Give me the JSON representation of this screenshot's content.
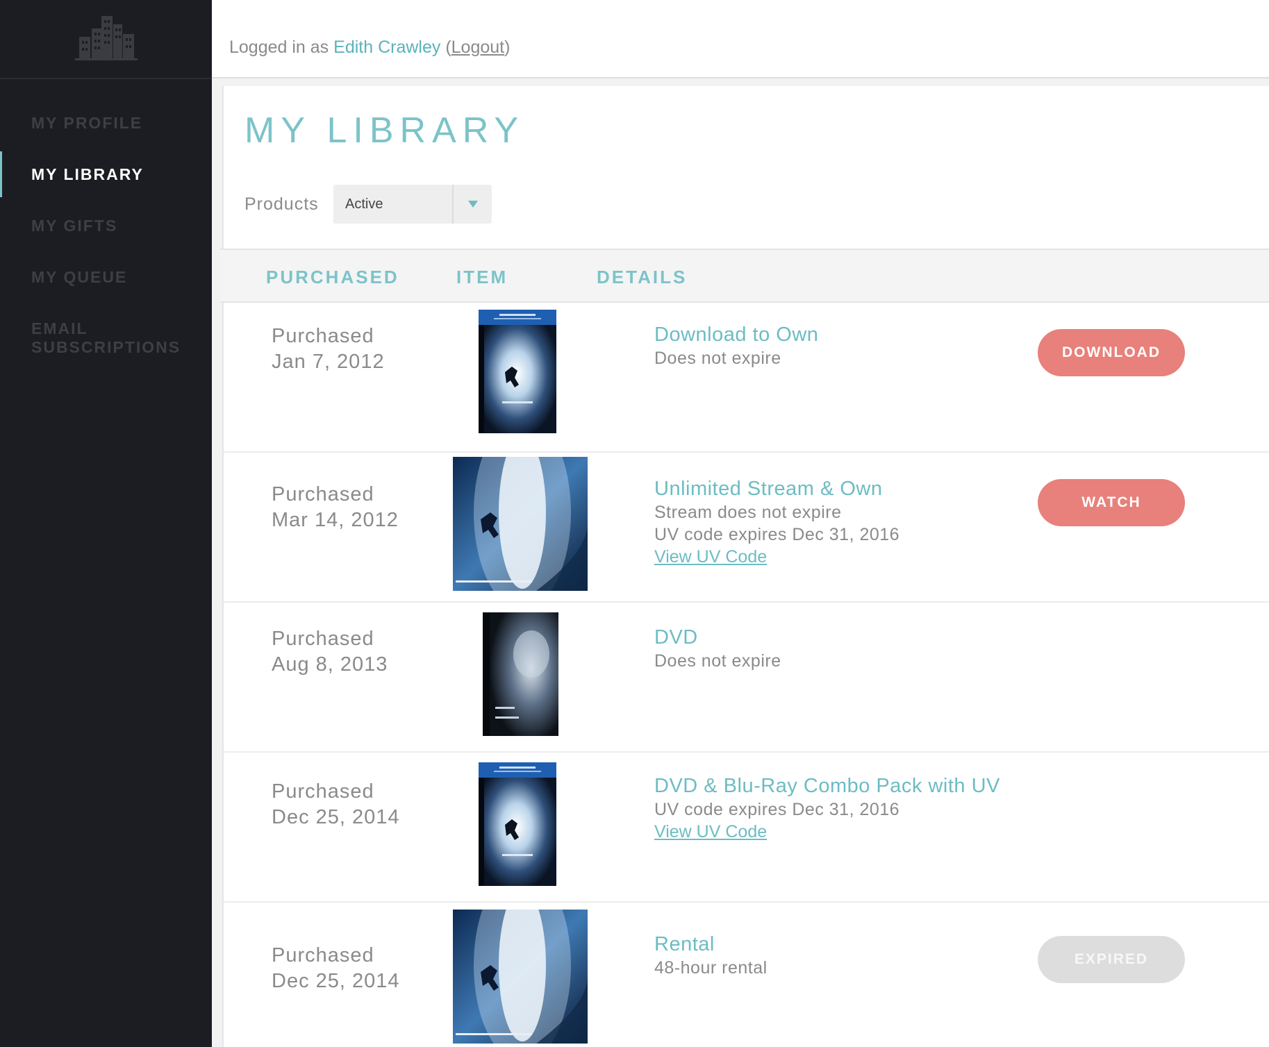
{
  "colors": {
    "accent": "#7cc3c9",
    "button": "#e8807b",
    "sidebar": "#1c1d22",
    "disabled": "#dddddd"
  },
  "sidebar": {
    "logo_icon": "city-buildings-icon",
    "items": [
      {
        "label": "MY PROFILE",
        "active": false
      },
      {
        "label": "MY LIBRARY",
        "active": true
      },
      {
        "label": "MY GIFTS",
        "active": false
      },
      {
        "label": "MY QUEUE",
        "active": false
      },
      {
        "label": "EMAIL SUBSCRIPTIONS",
        "active": false
      }
    ]
  },
  "header": {
    "logged_in_prefix": "Logged in as",
    "user_name": "Edith Crawley",
    "logout_label": "Logout"
  },
  "main": {
    "title": "MY LIBRARY",
    "filter": {
      "label": "Products",
      "value": "Active"
    },
    "columns": {
      "purchased": "PURCHASED",
      "item": "ITEM",
      "details": "DETAILS"
    },
    "rows": [
      {
        "purchased_label": "Purchased",
        "date": "Jan 7, 2012",
        "cover": "bluray-box",
        "title": "Download to Own",
        "lines": [
          "Does not expire"
        ],
        "link": "",
        "action": "DOWNLOAD",
        "action_state": "active"
      },
      {
        "purchased_label": "Purchased",
        "date": "Mar 14, 2012",
        "cover": "poster",
        "title": "Unlimited Stream & Own",
        "lines": [
          "Stream does not expire",
          "UV code expires Dec 31, 2016"
        ],
        "link": "View UV Code",
        "action": "WATCH",
        "action_state": "active"
      },
      {
        "purchased_label": "Purchased",
        "date": "Aug 8, 2013",
        "cover": "dvd-box",
        "title": "DVD",
        "lines": [
          "Does not expire"
        ],
        "link": "",
        "action": "",
        "action_state": "none"
      },
      {
        "purchased_label": "Purchased",
        "date": "Dec 25, 2014",
        "cover": "bluray-box",
        "title": "DVD & Blu-Ray Combo Pack with UV",
        "lines": [
          "UV code expires Dec 31, 2016"
        ],
        "link": "View UV Code",
        "action": "",
        "action_state": "none"
      },
      {
        "purchased_label": "Purchased",
        "date": "Dec 25, 2014",
        "cover": "poster",
        "title": "Rental",
        "lines": [
          "48-hour rental"
        ],
        "link": "",
        "action": "EXPIRED",
        "action_state": "disabled"
      }
    ]
  }
}
